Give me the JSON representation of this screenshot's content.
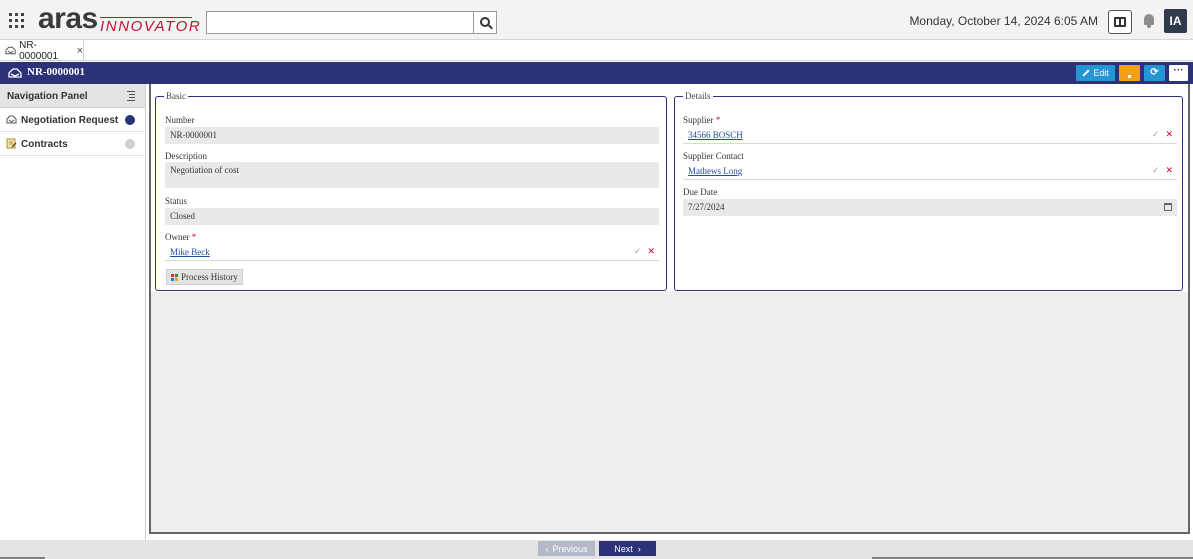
{
  "header": {
    "logo_main": "aras",
    "logo_sub": "INNOVATOR",
    "search_placeholder": "",
    "datetime": "Monday, October 14, 2024 6:05 AM",
    "avatar_initials": "IA"
  },
  "tabs": [
    {
      "label": "NR-0000001",
      "close": "×"
    }
  ],
  "titlebar": {
    "title": "NR-0000001",
    "edit_label": "Edit",
    "refresh_symbol": "⟳",
    "more_symbol": "···"
  },
  "nav": {
    "title": "Navigation Panel",
    "items": [
      {
        "label": "Negotiation Request",
        "status_color": "#2d317a",
        "icon": "negotiation-icon"
      },
      {
        "label": "Contracts",
        "status_color": "#cfcfcf",
        "icon": "contracts-icon"
      }
    ]
  },
  "basic": {
    "legend": "Basic",
    "number_label": "Number",
    "number_value": "NR-0000001",
    "description_label": "Description",
    "description_value": "Negotiation of cost",
    "status_label": "Status",
    "status_value": "Closed",
    "owner_label": "Owner",
    "owner_value": "Mike Beck",
    "process_history_label": "Process History"
  },
  "details": {
    "legend": "Details",
    "supplier_label": "Supplier",
    "supplier_value": "34566 BOSCH",
    "supplier_contact_label": "Supplier Contact",
    "supplier_contact_value": "Mathews Long",
    "due_date_label": "Due Date",
    "due_date_value": "7/27/2024"
  },
  "footer": {
    "previous_label": "Previous",
    "next_label": "Next"
  },
  "colors": {
    "brand_navy": "#2d317a",
    "accent_blue": "#2596d4",
    "accent_orange": "#f0a019",
    "logo_red": "#c8102e"
  }
}
